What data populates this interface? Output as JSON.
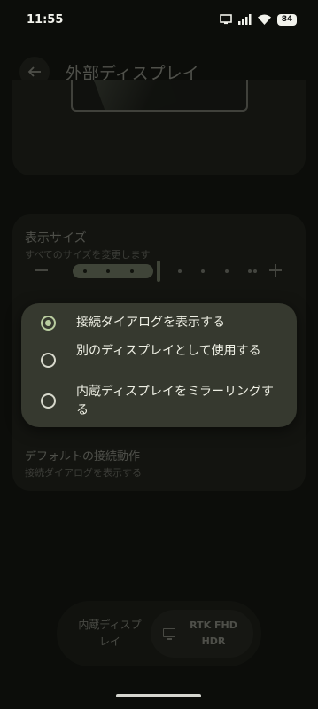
{
  "status_bar": {
    "time": "11:55",
    "battery": "84",
    "icons": [
      "cast-icon",
      "signal-icon",
      "wifi-icon",
      "battery-icon"
    ]
  },
  "app_bar": {
    "title": "外部ディスプレイ",
    "back_icon": "back-arrow-icon"
  },
  "display_size": {
    "title": "表示サイズ",
    "subtitle": "すべてのサイズを変更します",
    "minus_icon": "minus-icon",
    "plus_icon": "plus-icon",
    "step_count": 9,
    "current_step": 3
  },
  "default_connection": {
    "title": "デフォルトの接続動作",
    "subtitle": "接続ダイアログを表示する"
  },
  "popup": {
    "options": [
      {
        "label": "接続ダイアログを表示する",
        "selected": true
      },
      {
        "label": "別のディスプレイとして使用する",
        "selected": false
      },
      {
        "label": "内蔵ディスプレイをミラーリングする",
        "selected": false
      }
    ]
  },
  "bottom_switcher": {
    "left_label": "内蔵ディスプレイ",
    "right_label": "RTK FHD HDR",
    "right_icon": "monitor-icon"
  },
  "colors": {
    "accent": "#b9cc9f",
    "background": "#0c0d0a",
    "popup": "#36392f"
  }
}
